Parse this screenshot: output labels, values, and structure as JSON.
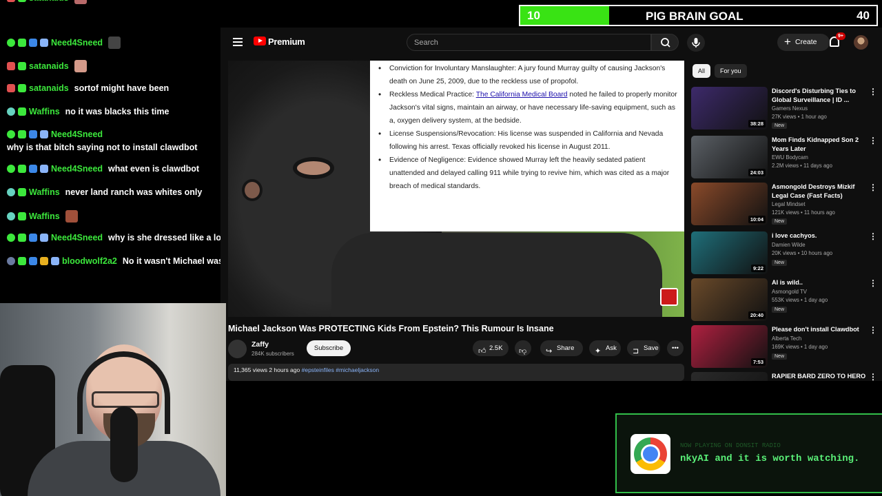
{
  "chat": [
    {
      "user": "satanaids",
      "color": "#3ce83c",
      "message": "",
      "top": 0
    },
    {
      "user": "Need4Sneed",
      "color": "#3ce83c",
      "message": ""
    },
    {
      "user": "satanaids",
      "color": "#3ce83c",
      "message": ""
    },
    {
      "user": "satanaids",
      "color": "#3ce83c",
      "message": "sortof might have been"
    },
    {
      "user": "Waffins",
      "color": "#3ce83c",
      "message": "no it was blacks this time"
    },
    {
      "user": "Need4Sneed",
      "color": "#3ce83c",
      "message": "why is that bitch saying not to install clawdbot"
    },
    {
      "user": "Need4Sneed",
      "color": "#3ce83c",
      "message": "what even is clawdbot"
    },
    {
      "user": "Waffins",
      "color": "#3ce83c",
      "message": "never land ranch was whites only"
    },
    {
      "user": "Waffins",
      "color": "#3ce83c",
      "message": ""
    },
    {
      "user": "Need4Sneed",
      "color": "#3ce83c",
      "message": "why is she dressed like a lobster"
    },
    {
      "user": "bloodwolf2a2",
      "color": "#3ce83c",
      "message": "No it wasn't Michael was there"
    }
  ],
  "goal": {
    "current": "10",
    "title": "PIG BRAIN GOAL",
    "target": "40",
    "fill_fraction": 0.25
  },
  "youtube": {
    "brand": "Premium",
    "search_placeholder": "Search",
    "create_label": "Create",
    "notif_count": "9+",
    "doc": {
      "b1": "Conviction for Involuntary Manslaughter: A jury found Murray guilty of causing Jackson's death on June 25, 2009, due to the reckless use of propofol.",
      "b2_pre": "Reckless Medical Practice: ",
      "b2_link": "The California Medical Board",
      "b2_post": " noted he failed to properly monitor Jackson's vital signs, maintain an airway, or have necessary life-saving equipment, such as a, oxygen delivery system, at the bedside.",
      "b3": "License Suspensions/Revocation: His license was suspended in California and Nevada following his arrest. Texas officially revoked his license in August 2011.",
      "b4": "Evidence of Negligence: Evidence showed Murray left the heavily sedated patient unattended and delayed calling 911 while trying to revive him, which was cited as a major breach of medical standards."
    },
    "video_title": "Michael Jackson Was PROTECTING Kids From Epstein? This Rumour Is Insane",
    "channel": "Zaffy",
    "subscribers": "284K subscribers",
    "subscribe_label": "Subscribe",
    "likes": "2.5K",
    "share_label": "Share",
    "ask_label": "Ask",
    "save_label": "Save",
    "desc_views": "11,365 views  2 hours ago",
    "desc_tags": "#epsteinfiles #michaeljackson",
    "chips": [
      "All",
      "For you"
    ],
    "recs": [
      {
        "title": "Discord's Disturbing Ties to Global Surveillance | ID ...",
        "channel": "Gamers Nexus",
        "meta": "27K views • 1 hour ago",
        "duration": "38:28",
        "new": "New",
        "color": "#3d2a6b"
      },
      {
        "title": "Mom Finds Kidnapped Son 2 Years Later",
        "channel": "EWU Bodycam",
        "meta": "2.2M views • 11 days ago",
        "duration": "24:03",
        "new": "",
        "color": "#5b6066"
      },
      {
        "title": "Asmongold Destroys Mizkif Legal Case (Fast Facts)",
        "channel": "Legal Mindset",
        "meta": "121K views • 11 hours ago",
        "duration": "10:04",
        "new": "New",
        "color": "#8a4a2a"
      },
      {
        "title": "i love cachyos.",
        "channel": "Damien Wilde",
        "meta": "20K views • 10 hours ago",
        "duration": "9:22",
        "new": "New",
        "color": "#1f6f7a"
      },
      {
        "title": "AI is wild..",
        "channel": "Asmongold TV",
        "meta": "553K views • 1 day ago",
        "duration": "20:40",
        "new": "New",
        "color": "#6a4a2a"
      },
      {
        "title": "Please don't install Clawdbot",
        "channel": "Alberta Tech",
        "meta": "169K views • 1 day ago",
        "duration": "7:53",
        "new": "New",
        "color": "#b02040"
      },
      {
        "title": "RAPIER BARD ZERO TO HERO",
        "channel": "",
        "meta": "",
        "duration": "",
        "new": "",
        "color": "#2a2a2a"
      }
    ]
  },
  "now_playing": {
    "label": "NOW PLAYING ON DONSIT RADIO",
    "text": "nkyAI and it is worth watching."
  }
}
